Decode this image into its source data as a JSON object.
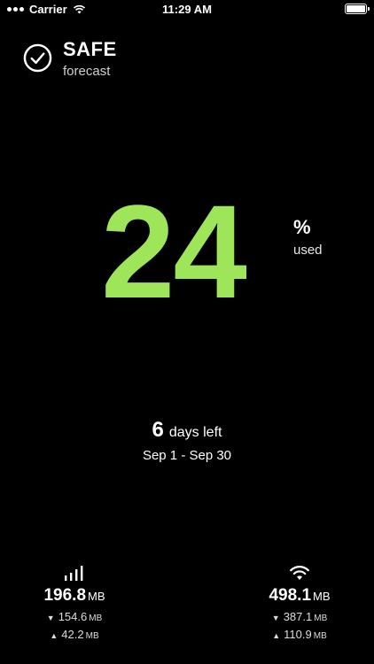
{
  "status_bar": {
    "carrier": "Carrier",
    "time": "11:29 AM",
    "icons": [
      "wifi-icon",
      "battery-icon"
    ]
  },
  "header": {
    "title": "SAFE",
    "subtitle": "forecast",
    "icon": "check-circle-icon"
  },
  "usage": {
    "percent": "24",
    "unit": "%",
    "label": "used",
    "color": "#9ee55a"
  },
  "period": {
    "days_left": "6",
    "days_label": "days left",
    "range": "Sep 1 - Sep 30"
  },
  "cellular": {
    "icon": "cellular-signal-icon",
    "total": "196.8",
    "total_unit": "MB",
    "download": "154.6",
    "download_unit": "MB",
    "upload": "42.2",
    "upload_unit": "MB"
  },
  "wifi": {
    "icon": "wifi-icon",
    "total": "498.1",
    "total_unit": "MB",
    "download": "387.1",
    "download_unit": "MB",
    "upload": "110.9",
    "upload_unit": "MB"
  }
}
